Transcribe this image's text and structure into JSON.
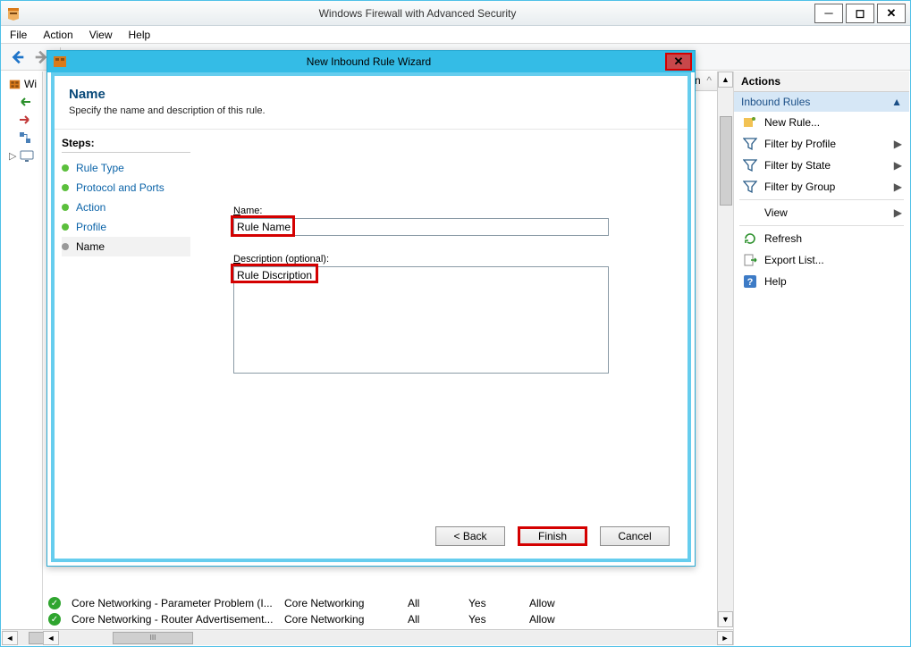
{
  "window": {
    "title": "Windows Firewall with Advanced Security",
    "menus": [
      "File",
      "Action",
      "View",
      "Help"
    ]
  },
  "tree": {
    "root_partial": "Wi"
  },
  "wizard": {
    "title": "New Inbound Rule Wizard",
    "heading": "Name",
    "subheading": "Specify the name and description of this rule.",
    "steps_label": "Steps:",
    "steps": [
      {
        "label": "Rule Type"
      },
      {
        "label": "Protocol and Ports"
      },
      {
        "label": "Action"
      },
      {
        "label": "Profile"
      },
      {
        "label": "Name",
        "current": true
      }
    ],
    "name_label_pre": "N",
    "name_label_rest": "ame:",
    "name_value": "Rule Name",
    "desc_label_pre": "D",
    "desc_label_rest": "escription (optional):",
    "desc_value": "Rule Discription",
    "buttons": {
      "back": "< Back",
      "finish": "Finish",
      "cancel": "Cancel"
    }
  },
  "center_rows": [
    {
      "name": "Core Networking - Parameter Problem (I...",
      "group": "Core Networking",
      "profile": "All",
      "enabled": "Yes",
      "action": "Allow"
    },
    {
      "name": "Core Networking - Router Advertisement...",
      "group": "Core Networking",
      "profile": "All",
      "enabled": "Yes",
      "action": "Allow"
    }
  ],
  "center_header_fragment": "on",
  "actions": {
    "header": "Actions",
    "group_title": "Inbound Rules",
    "items": [
      {
        "label": "New Rule...",
        "icon": "new-rule-icon"
      },
      {
        "label": "Filter by Profile",
        "icon": "filter-icon",
        "submenu": true
      },
      {
        "label": "Filter by State",
        "icon": "filter-icon",
        "submenu": true
      },
      {
        "label": "Filter by Group",
        "icon": "filter-icon",
        "submenu": true
      },
      {
        "label": "View",
        "icon": "",
        "submenu": true
      },
      {
        "label": "Refresh",
        "icon": "refresh-icon"
      },
      {
        "label": "Export List...",
        "icon": "export-icon"
      },
      {
        "label": "Help",
        "icon": "help-icon"
      }
    ]
  }
}
